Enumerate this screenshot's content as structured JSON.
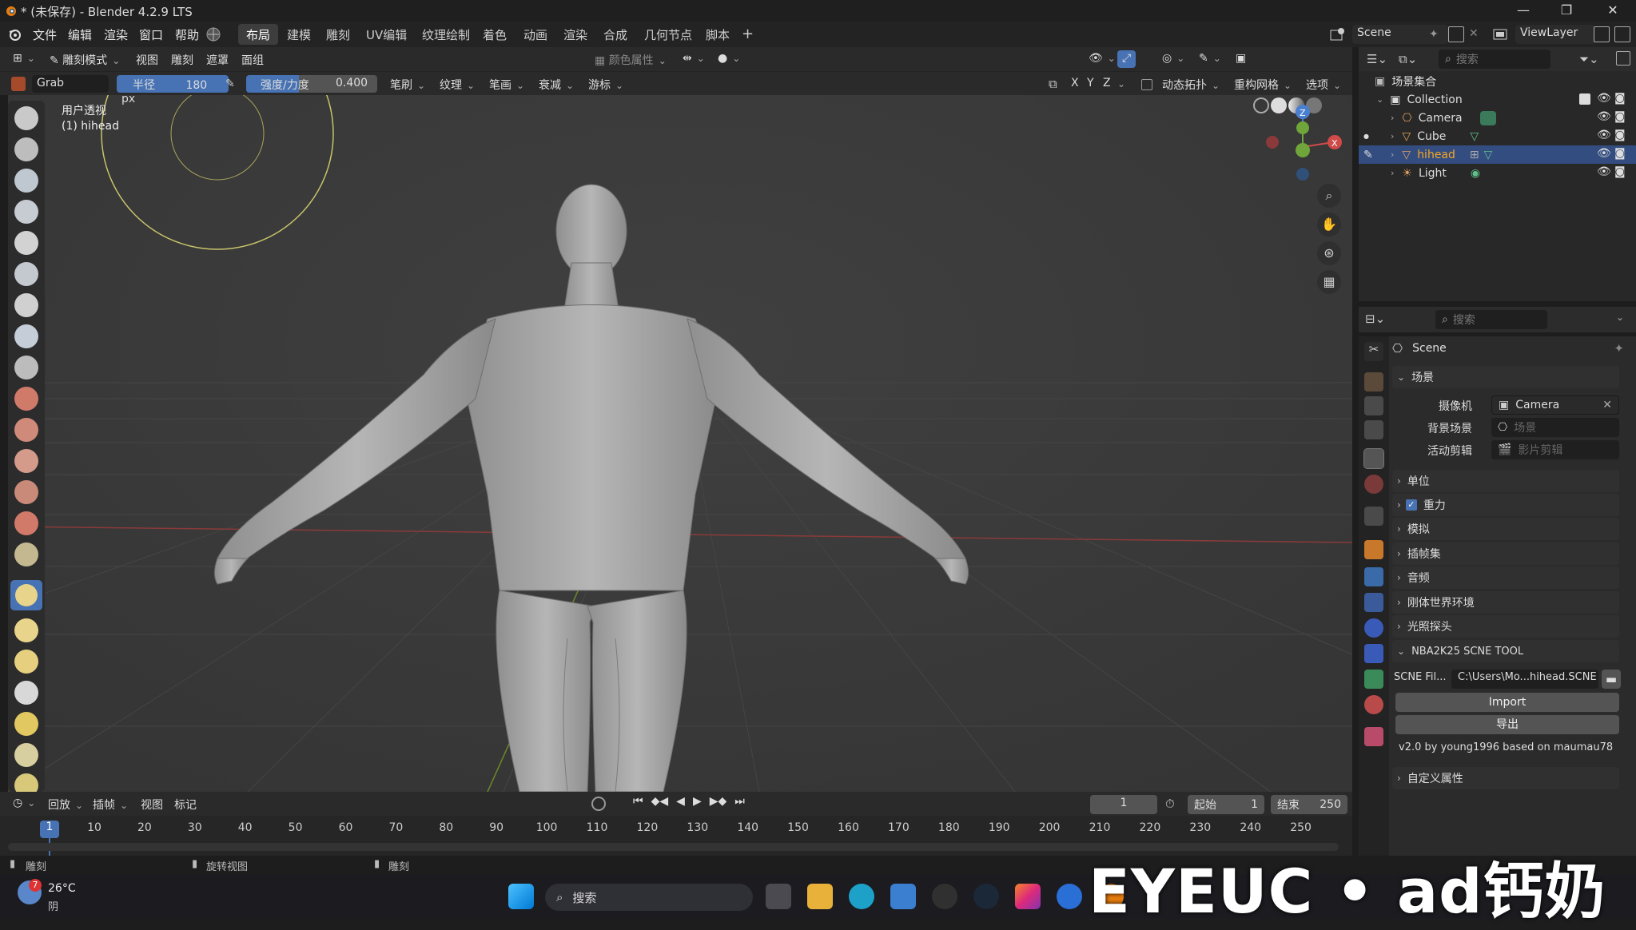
{
  "window": {
    "title": "* (未保存) - Blender 4.2.9 LTS"
  },
  "menu": [
    "文件",
    "编辑",
    "渲染",
    "窗口",
    "帮助"
  ],
  "workspaces": [
    "布局",
    "建模",
    "雕刻",
    "UV编辑",
    "纹理绘制",
    "着色",
    "动画",
    "渲染",
    "合成",
    "几何节点",
    "脚本"
  ],
  "active_workspace": "布局",
  "scene": {
    "name": "Scene",
    "view_layer": "ViewLayer"
  },
  "header": {
    "mode": "雕刻模式",
    "menus": [
      "视图",
      "雕刻",
      "遮罩",
      "面组"
    ],
    "color_attr": "颜色属性",
    "brush_name": "Grab",
    "radius_label": "半径",
    "radius_value": "180 px",
    "strength_label": "强度/力度",
    "strength_value": "0.400",
    "dropdowns": [
      "笔刷",
      "纹理",
      "笔画",
      "衰减",
      "游标"
    ],
    "axes": [
      "X",
      "Y",
      "Z"
    ],
    "dyntopo": "动态拓扑",
    "remesh": "重构网格",
    "options": "选项"
  },
  "viewport": {
    "view_name": "用户透视",
    "object_label": "(1) hihead"
  },
  "outliner": {
    "search_placeholder": "搜索",
    "scene_collection": "场景集合",
    "collection": "Collection",
    "items": [
      {
        "name": "Camera",
        "selected": false
      },
      {
        "name": "Cube",
        "selected": false
      },
      {
        "name": "hihead",
        "selected": true
      },
      {
        "name": "Light",
        "selected": false
      }
    ]
  },
  "properties": {
    "search_placeholder": "搜索",
    "context": "Scene",
    "scene_panel": "场景",
    "camera_label": "摄像机",
    "camera_value": "Camera",
    "bg_scene_label": "背景场景",
    "bg_scene_placeholder": "场景",
    "active_clip_label": "活动剪辑",
    "active_clip_placeholder": "影片剪辑",
    "panels": [
      "单位",
      "重力",
      "模拟",
      "插帧集",
      "音频",
      "刚体世界环境",
      "光照探头"
    ],
    "tool_panel": "NBA2K25 SCNE TOOL",
    "scne_label": "SCNE Fil...",
    "scne_value": "C:\\Users\\Mo...hihead.SCNE",
    "import_btn": "Import",
    "export_btn": "导出",
    "credit": "v2.0  by young1996 based on maumau78",
    "custom_props": "自定义属性"
  },
  "timeline": {
    "menus": [
      "回放",
      "插帧",
      "视图",
      "标记"
    ],
    "current_frame": "1",
    "start_label": "起始",
    "start": "1",
    "end_label": "结束",
    "end": "250",
    "ticks": [
      "10",
      "20",
      "30",
      "40",
      "50",
      "60",
      "70",
      "80",
      "90",
      "100",
      "110",
      "120",
      "130",
      "140",
      "150",
      "160",
      "170",
      "180",
      "190",
      "200",
      "210",
      "220",
      "230",
      "240",
      "250"
    ]
  },
  "status": [
    "雕刻",
    "旋转视图",
    "雕刻"
  ],
  "taskbar": {
    "temp": "26°C",
    "weather": "阴",
    "badge": "7",
    "search": "搜索"
  },
  "watermark": "EYEUC • ad钙奶"
}
